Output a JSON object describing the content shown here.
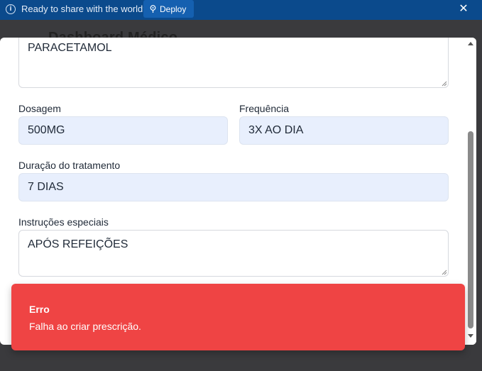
{
  "topbar": {
    "message": "Ready to share with the world?",
    "deploy_label": "Deploy",
    "info_icon": "i",
    "close_icon": "✕"
  },
  "background": {
    "page_title": "Dashboard Médico"
  },
  "form": {
    "medication_value": "PARACETAMOL",
    "dosage_label": "Dosagem",
    "dosage_value": "500MG",
    "frequency_label": "Frequência",
    "frequency_value": "3X AO DIA",
    "duration_label": "Duração do tratamento",
    "duration_value": "7 DIAS",
    "instructions_label": "Instruções especiais",
    "instructions_value": "APÓS REFEIÇÕES"
  },
  "toast": {
    "title": "Erro",
    "message": "Falha ao criar prescrição.",
    "color": "#ef4444"
  },
  "colors": {
    "topbar": "#0b4a8c",
    "input_fill": "#e8effd"
  }
}
